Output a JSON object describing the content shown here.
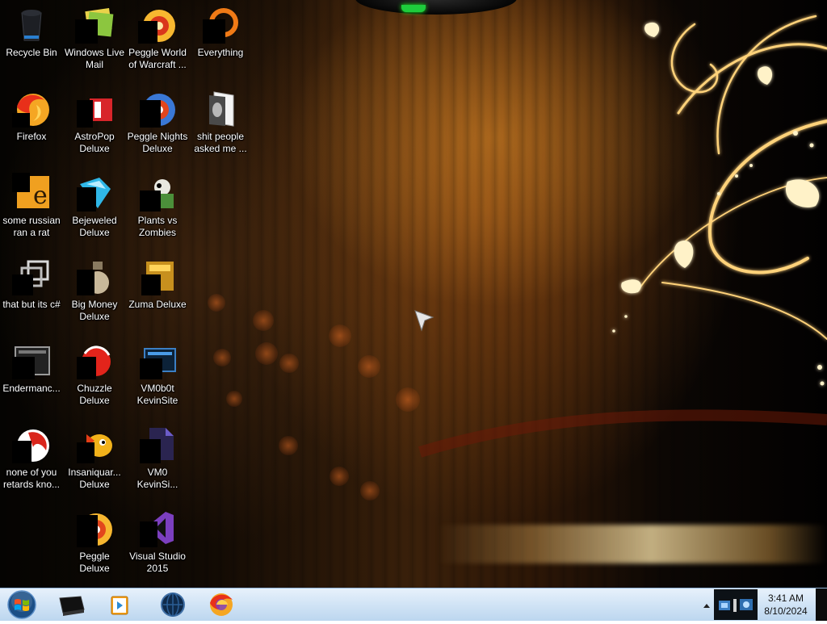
{
  "desktop": {
    "icons": [
      {
        "id": "recycle-bin",
        "label": "Recycle Bin"
      },
      {
        "id": "windows-live-mail",
        "label": "Windows Live\nMail"
      },
      {
        "id": "peggle-world-of-warcraft",
        "label": "Peggle World\nof Warcraft ..."
      },
      {
        "id": "everything",
        "label": "Everything"
      },
      {
        "id": "firefox",
        "label": "Firefox"
      },
      {
        "id": "astropop-deluxe",
        "label": "AstroPop\nDeluxe"
      },
      {
        "id": "peggle-nights-deluxe",
        "label": "Peggle Nights\nDeluxe"
      },
      {
        "id": "shit-people-asked-me",
        "label": "shit people\nasked me ..."
      },
      {
        "id": "some-russian-ran-a-rat",
        "label": "some russian\nran a rat"
      },
      {
        "id": "bejeweled-deluxe",
        "label": "Bejeweled\nDeluxe"
      },
      {
        "id": "plants-vs-zombies",
        "label": "Plants vs\nZombies"
      },
      {
        "id": "that-but-its-csharp",
        "label": "that but its c#"
      },
      {
        "id": "big-money-deluxe",
        "label": "Big Money\nDeluxe"
      },
      {
        "id": "zuma-deluxe",
        "label": "Zuma Deluxe"
      },
      {
        "id": "endermanch",
        "label": "Endermanc..."
      },
      {
        "id": "chuzzle-deluxe",
        "label": "Chuzzle\nDeluxe"
      },
      {
        "id": "vm0b0t-kevinsite",
        "label": "VM0b0t\nKevinSite"
      },
      {
        "id": "none-of-you-retards",
        "label": "none of you\nretards kno..."
      },
      {
        "id": "insaniquarium-deluxe",
        "label": "Insaniquar...\nDeluxe"
      },
      {
        "id": "vm0-kevinsi",
        "label": "VM0\nKevinSi..."
      },
      {
        "id": "peggle-deluxe",
        "label": "Peggle Deluxe"
      },
      {
        "id": "visual-studio-2015",
        "label": "Visual Studio\n2015"
      }
    ]
  },
  "taskbar": {
    "pinned": [
      "terminal-icon",
      "media-player-icon",
      "globe-icon",
      "firefox-icon"
    ],
    "clock": {
      "time": "3:41 AM",
      "date": "8/10/2024"
    }
  },
  "colors": {
    "taskbar_top": "#e7f1fb",
    "taskbar_bottom": "#bcd6ef",
    "accent_gold": "#ffc24a",
    "accent_green": "#1ecc3c"
  }
}
